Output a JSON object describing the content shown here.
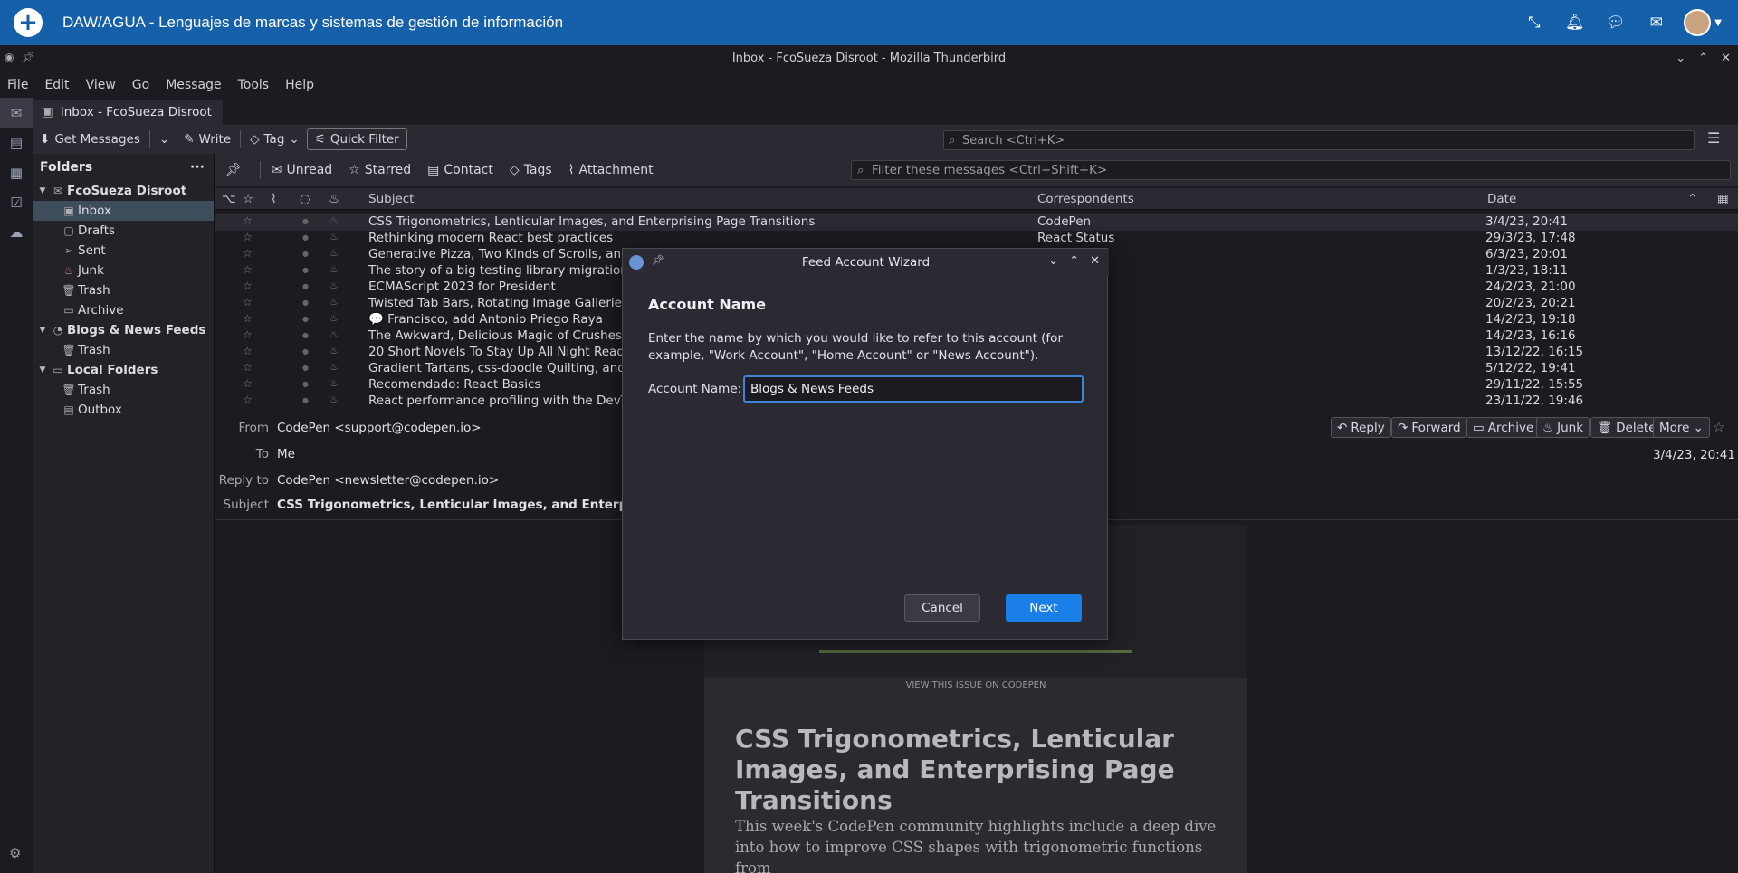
{
  "topbar": {
    "course_title": "DAW/AGUA - Lenguajes de marcas y sistemas de gestión de información",
    "icons": [
      "compress-icon",
      "bell-icon",
      "chat-icon",
      "envelope-icon",
      "avatar"
    ]
  },
  "window": {
    "title": "Inbox - FcoSueza Disroot - Mozilla Thunderbird"
  },
  "menubar": [
    "File",
    "Edit",
    "View",
    "Go",
    "Message",
    "Tools",
    "Help"
  ],
  "tab": {
    "label": "Inbox - FcoSueza Disroot"
  },
  "toolbar": {
    "get_messages": "Get Messages",
    "write": "Write",
    "tag": "Tag",
    "quick_filter": "Quick Filter",
    "search_placeholder": "Search <Ctrl+K>"
  },
  "folders": {
    "header": "Folders",
    "more": "···",
    "items": [
      {
        "label": "FcoSueza Disroot",
        "type": "account"
      },
      {
        "label": "Inbox",
        "type": "folder"
      },
      {
        "label": "Drafts",
        "type": "folder"
      },
      {
        "label": "Sent",
        "type": "folder"
      },
      {
        "label": "Junk",
        "type": "folder"
      },
      {
        "label": "Trash",
        "type": "folder"
      },
      {
        "label": "Archive",
        "type": "folder"
      },
      {
        "label": "Blogs & News Feeds",
        "type": "account"
      },
      {
        "label": "Trash",
        "type": "folder"
      },
      {
        "label": "Local Folders",
        "type": "account"
      },
      {
        "label": "Trash",
        "type": "folder"
      },
      {
        "label": "Outbox",
        "type": "folder"
      }
    ]
  },
  "quickfilter": {
    "unread": "Unread",
    "starred": "Starred",
    "contact": "Contact",
    "tags": "Tags",
    "attachment": "Attachment",
    "filter_placeholder": "Filter these messages <Ctrl+Shift+K>"
  },
  "columns": {
    "subject": "Subject",
    "correspondents": "Correspondents",
    "date": "Date"
  },
  "messages": [
    {
      "subject": "CSS Trigonometrics, Lenticular Images, and Enterprising Page Transitions",
      "correspondent": "CodePen",
      "date": "3/4/23, 20:41"
    },
    {
      "subject": "Rethinking modern React best practices",
      "correspondent": "React Status",
      "date": "29/3/23, 17:48"
    },
    {
      "subject": "Generative Pizza, Two Kinds of Scrolls, and De",
      "correspondent": "",
      "date": "6/3/23, 20:01"
    },
    {
      "subject": "The story of a big testing library migration",
      "correspondent": "",
      "date": "1/3/23, 18:11"
    },
    {
      "subject": "ECMAScript 2023 for President",
      "correspondent": "eekly",
      "date": "24/2/23, 21:00"
    },
    {
      "subject": "Twisted Tab Bars, Rotating Image Galleries, a",
      "correspondent": "",
      "date": "20/2/23, 20:21"
    },
    {
      "subject": "💬 Francisco, add Antonio Priego Raya",
      "correspondent": "",
      "date": "14/2/23, 19:18"
    },
    {
      "subject": "The Awkward, Delicious Magic of Crushes",
      "correspondent": "",
      "date": "14/2/23, 16:16"
    },
    {
      "subject": "20 Short Novels To Stay Up All Night Reading",
      "correspondent": "",
      "date": "13/12/22, 16:15"
    },
    {
      "subject": "Gradient Tartans, css-doodle Quilting, and Va",
      "correspondent": "",
      "date": "5/12/22, 19:41"
    },
    {
      "subject": "Recomendado: React Basics",
      "correspondent": "",
      "date": "29/11/22, 15:55"
    },
    {
      "subject": "React performance profiling with the DevToo",
      "correspondent": "",
      "date": "23/11/22, 19:46"
    }
  ],
  "message_header": {
    "from_label": "From",
    "from_value": "CodePen <support@codepen.io>",
    "to_label": "To",
    "to_value": "Me",
    "replyto_label": "Reply to",
    "replyto_value": "CodePen <newsletter@codepen.io>",
    "subject_label": "Subject",
    "subject_value": "CSS Trigonometrics, Lenticular Images, and Enterprising P",
    "date": "3/4/23, 20:41",
    "actions": [
      "Reply",
      "Forward",
      "Archive",
      "Junk",
      "Delete",
      "More"
    ]
  },
  "newsletter": {
    "view_link": "VIEW THIS ISSUE ON CODEPEN",
    "title": "CSS Trigonometrics, Lenticular Images, and Enterprising Page Transitions",
    "text": "This week's CodePen community highlights include a deep dive into how to improve CSS shapes with trigonometric functions from"
  },
  "dialog": {
    "title": "Feed Account Wizard",
    "heading": "Account Name",
    "description": "Enter the name by which you would like to refer to this account (for example, \"Work Account\", \"Home Account\" or \"News Account\").",
    "field_label": "Account Name:",
    "field_value": "Blogs & News Feeds",
    "cancel": "Cancel",
    "next": "Next"
  },
  "colors": {
    "topbar": "#1560a8",
    "accent": "#1a7ee8",
    "selected_folder": "#3e4d5c"
  }
}
